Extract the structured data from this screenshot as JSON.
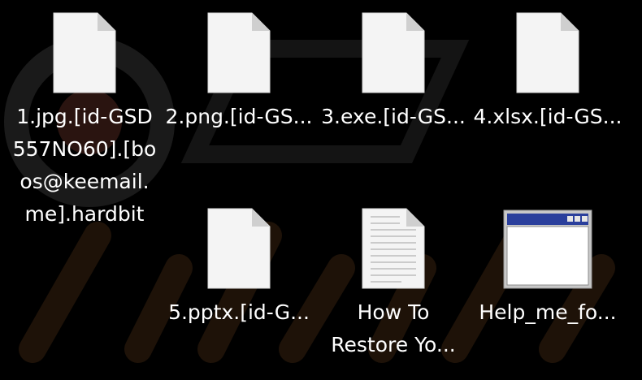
{
  "colors": {
    "background": "#000000",
    "label_text": "#ffffff",
    "icon_page": "#f4f4f4",
    "icon_fold": "#cfcfcf",
    "window_titlebar": "#2a3f9c"
  },
  "files": [
    {
      "label": "1.jpg.[id-GSD\n557NO60].[bo\nos@keemail.\nme].hardbit",
      "icon": "blank-file-icon"
    },
    {
      "label": "2.png.[id-GS...",
      "icon": "blank-file-icon"
    },
    {
      "label": "3.exe.[id-GS...",
      "icon": "blank-file-icon"
    },
    {
      "label": "4.xlsx.[id-GS...",
      "icon": "blank-file-icon"
    },
    {
      "label": "5.pptx.[id-G...",
      "icon": "blank-file-icon"
    },
    {
      "label": "How To\nRestore Yo...",
      "icon": "text-document-icon"
    },
    {
      "label": "Help_me_fo...",
      "icon": "application-window-icon"
    }
  ]
}
